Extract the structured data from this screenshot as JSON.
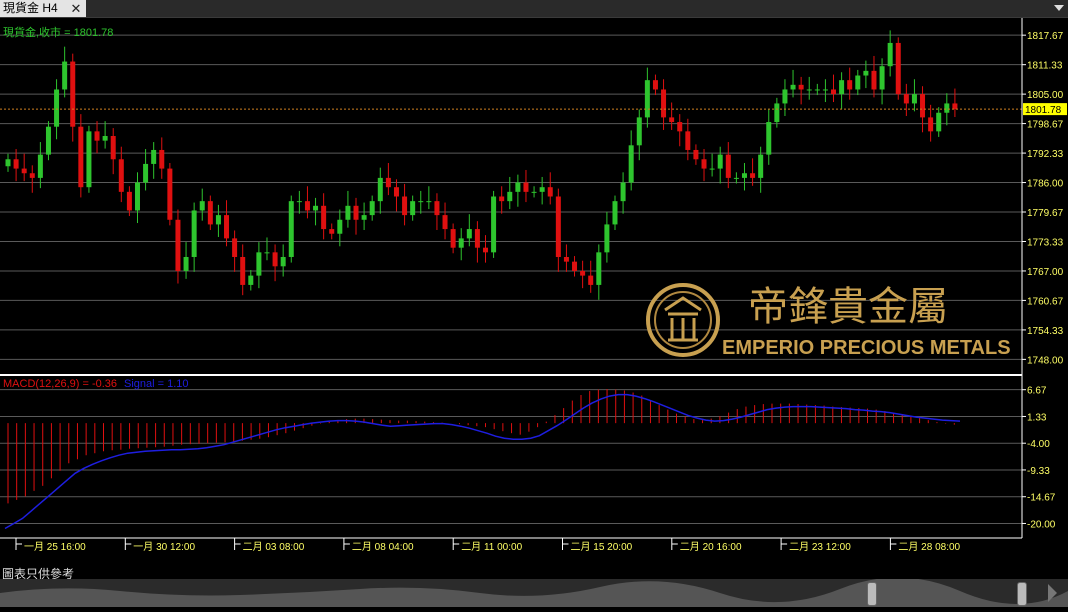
{
  "tab": {
    "title": "現貨金 H4",
    "close": "✕"
  },
  "footer": {
    "disclaimer": "圖表只供參考"
  },
  "watermark": {
    "chinese": "帝鋒貴金屬",
    "english": "EMPERIO PRECIOUS METALS"
  },
  "colors": {
    "up": "#2ec52e",
    "down": "#e01010",
    "signal": "#1e1ee0",
    "price_text": "#ffff66",
    "last_price_bg": "#ffff00",
    "gold": "#c8a050"
  },
  "chart_data": {
    "type": "candlestick",
    "series_label": "現貨金,收市 = 1801.78",
    "last_price": 1801.78,
    "price_axis_ticks": [
      "1817.67",
      "1811.33",
      "1805.00",
      "1798.67",
      "1792.33",
      "1786.00",
      "1779.67",
      "1773.33",
      "1767.00",
      "1760.67",
      "1754.33",
      "1748.00"
    ],
    "ylim": [
      1745.5,
      1820.5
    ],
    "x_tick_labels": [
      "一月 25 16:00",
      "一月 30 12:00",
      "二月 03 08:00",
      "二月 08 04:00",
      "二月 11 00:00",
      "二月 15 20:00",
      "二月 20 16:00",
      "二月 23 12:00",
      "二月 28 08:00"
    ],
    "closes": [
      1791,
      1789,
      1788,
      1787,
      1792,
      1798,
      1806,
      1812,
      1798,
      1785,
      1797,
      1795,
      1796,
      1791,
      1784,
      1780,
      1786,
      1790,
      1793,
      1789,
      1778,
      1767,
      1770,
      1780,
      1782,
      1777,
      1779,
      1774,
      1770,
      1764,
      1766,
      1771,
      1771,
      1768,
      1770,
      1782,
      1782,
      1780,
      1781,
      1776,
      1775,
      1778,
      1781,
      1778,
      1779,
      1782,
      1787,
      1785,
      1783,
      1779,
      1782,
      1782,
      1782,
      1779,
      1776,
      1772,
      1774,
      1776,
      1772,
      1771,
      1783,
      1782,
      1784,
      1786,
      1784,
      1784,
      1785,
      1783,
      1770,
      1769,
      1767,
      1766,
      1764,
      1771,
      1777,
      1782,
      1786,
      1794,
      1800,
      1808,
      1806,
      1800,
      1799,
      1797,
      1793,
      1791,
      1789,
      1789,
      1792,
      1787,
      1787,
      1788,
      1787,
      1792,
      1799,
      1803,
      1806,
      1807,
      1806,
      1806,
      1806,
      1806,
      1805,
      1808,
      1806,
      1809,
      1810,
      1806,
      1811,
      1816,
      1805,
      1803,
      1805,
      1800,
      1797,
      1801,
      1803,
      1801.78
    ],
    "macd": {
      "label": "MACD(12,26,9) = -0.36",
      "signal_label": "Signal = 1.10",
      "ticks": [
        "6.67",
        "1.33",
        "-4.00",
        "-9.33",
        "-14.67",
        "-20.00"
      ],
      "ylim": [
        -22.5,
        9.0
      ],
      "hist": [
        -16,
        -15.3,
        -14.6,
        -13.5,
        -12.5,
        -11,
        -9.5,
        -8,
        -7.2,
        -6.4,
        -6,
        -5.6,
        -5.4,
        -5.3,
        -5.1,
        -5.0,
        -4.9,
        -4.8,
        -4.7,
        -4.5,
        -4.3,
        -4.2,
        -4.1,
        -4.0,
        -3.9,
        -3.8,
        -3.7,
        -3.5,
        -3.3,
        -3.1,
        -2.8,
        -2.4,
        -2.0,
        -1.5,
        -1.0,
        -0.5,
        -0.1,
        0.3,
        0.6,
        0.8,
        0.9,
        0.9,
        0.8,
        0.7,
        0.6,
        0.5,
        0.5,
        0.4,
        0.3,
        0.2,
        0.1,
        0,
        -0.2,
        -0.4,
        -0.6,
        -0.8,
        -1.2,
        -1.6,
        -2.0,
        -2.3,
        -1.7,
        -0.8,
        0.3,
        1.6,
        3.0,
        4.5,
        5.6,
        6.4,
        6.7,
        6.8,
        6.7,
        6.5,
        6.1,
        5.5,
        4.6,
        3.6,
        2.7,
        1.9,
        1.3,
        0.8,
        0.6,
        0.9,
        1.4,
        2.1,
        2.8,
        3.3,
        3.6,
        3.8,
        3.9,
        3.9,
        3.9,
        3.8,
        3.7,
        3.6,
        3.5,
        3.3,
        3.2,
        3.1,
        3.0,
        2.9,
        2.7,
        2.4,
        2.1,
        1.8,
        1.4,
        1.0,
        0.6,
        0.2,
        -0.1,
        -0.3
      ],
      "signal": [
        -21,
        -20,
        -19,
        -17.5,
        -16,
        -14.5,
        -13,
        -11.5,
        -10,
        -9,
        -8.2,
        -7.5,
        -6.9,
        -6.4,
        -6.0,
        -5.8,
        -5.6,
        -5.5,
        -5.4,
        -5.3,
        -5.3,
        -5.2,
        -5.1,
        -4.9,
        -4.6,
        -4.3,
        -3.8,
        -3.3,
        -2.8,
        -2.3,
        -1.8,
        -1.3,
        -0.9,
        -0.6,
        -0.3,
        0,
        0.2,
        0.4,
        0.5,
        0.5,
        0.4,
        0.2,
        -0.1,
        -0.4,
        -0.6,
        -0.5,
        -0.4,
        -0.3,
        -0.2,
        -0.1,
        -0.1,
        -0.3,
        -0.6,
        -1.0,
        -1.5,
        -2.0,
        -2.6,
        -3.0,
        -3.2,
        -3.2,
        -3.0,
        -2.5,
        -1.5,
        -0.5,
        0.6,
        1.8,
        3.0,
        4.0,
        4.8,
        5.4,
        5.7,
        5.7,
        5.4,
        4.9,
        4.3,
        3.6,
        2.9,
        2.2,
        1.5,
        1.0,
        0.6,
        0.4,
        0.5,
        0.8,
        1.2,
        1.7,
        2.2,
        2.7,
        3.0,
        3.2,
        3.3,
        3.3,
        3.3,
        3.2,
        3.1,
        3.0,
        2.9,
        2.7,
        2.6,
        2.4,
        2.3,
        2.1,
        1.8,
        1.5,
        1.2,
        1.0,
        0.8,
        0.6,
        0.5,
        0.4
      ]
    }
  }
}
